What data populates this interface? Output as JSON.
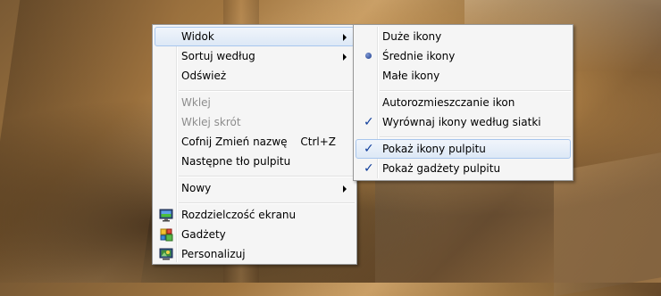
{
  "context_menu": {
    "items": [
      {
        "label": "Widok",
        "submenu": true,
        "highlighted": true
      },
      {
        "label": "Sortuj według",
        "submenu": true
      },
      {
        "label": "Odśwież"
      },
      {
        "label": "Wklej",
        "disabled": true
      },
      {
        "label": "Wklej skrót",
        "disabled": true
      },
      {
        "label": "Cofnij Zmień nazwę",
        "shortcut": "Ctrl+Z"
      },
      {
        "label": "Następne tło pulpitu"
      },
      {
        "label": "Nowy",
        "submenu": true
      },
      {
        "label": "Rozdzielczość ekranu",
        "icon": "monitor-icon"
      },
      {
        "label": "Gadżety",
        "icon": "gadgets-icon"
      },
      {
        "label": "Personalizuj",
        "icon": "personalize-icon"
      }
    ]
  },
  "view_submenu": {
    "items": [
      {
        "label": "Duże ikony"
      },
      {
        "label": "Średnie ikony",
        "selected": true
      },
      {
        "label": "Małe ikony"
      },
      {
        "label": "Autorozmieszczanie ikon",
        "checked": false
      },
      {
        "label": "Wyrównaj ikony według siatki",
        "checked": true
      },
      {
        "label": "Pokaż ikony pulpitu",
        "checked": true,
        "highlighted": true
      },
      {
        "label": "Pokaż gadżety pulpitu",
        "checked": true
      }
    ]
  }
}
